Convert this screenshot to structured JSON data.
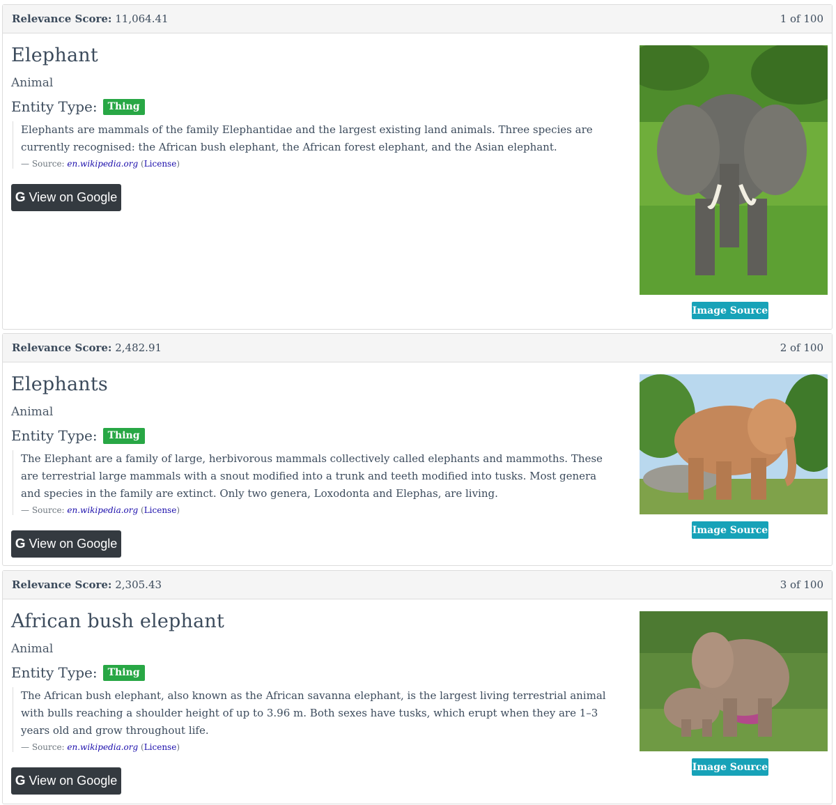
{
  "results": [
    {
      "score_label": "Relevance Score:",
      "score": "11,064.41",
      "position": "1 of 100",
      "title": "Elephant",
      "category": "Animal",
      "entity_type_label": "Entity Type:",
      "entity_type": "Thing",
      "description": "Elephants are mammals of the family Elephantidae and the largest existing land animals. Three species are currently recognised: the African bush elephant, the African forest elephant, and the Asian elephant.",
      "source_prefix": "— Source: ",
      "source_link": "en.wikipedia.org",
      "license_link": "License",
      "google_button": "View on Google",
      "image_source_button": "Image Source"
    },
    {
      "score_label": "Relevance Score:",
      "score": "2,482.91",
      "position": "2 of 100",
      "title": "Elephants",
      "category": "Animal",
      "entity_type_label": "Entity Type:",
      "entity_type": "Thing",
      "description": "The Elephant are a family of large, herbivorous mammals collectively called elephants and mammoths. These are terrestrial large mammals with a snout modified into a trunk and teeth modified into tusks. Most genera and species in the family are extinct. Only two genera, Loxodonta and Elephas, are living.",
      "source_prefix": "— Source: ",
      "source_link": "en.wikipedia.org",
      "license_link": "License",
      "google_button": "View on Google",
      "image_source_button": "Image Source"
    },
    {
      "score_label": "Relevance Score:",
      "score": "2,305.43",
      "position": "3 of 100",
      "title": "African bush elephant",
      "category": "Animal",
      "entity_type_label": "Entity Type:",
      "entity_type": "Thing",
      "description": "The African bush elephant, also known as the African savanna elephant, is the largest living terrestrial animal with bulls reaching a shoulder height of up to 3.96 m. Both sexes have tusks, which erupt when they are 1–3 years old and grow throughout life.",
      "source_prefix": "— Source: ",
      "source_link": "en.wikipedia.org",
      "license_link": "License",
      "google_button": "View on Google",
      "image_source_button": "Image Source"
    }
  ],
  "colors": {
    "header_bg": "#f5f5f5",
    "badge": "#28a745",
    "google_button": "#343a40",
    "image_source_button": "#17a2b8",
    "link": "#1a0dab"
  }
}
